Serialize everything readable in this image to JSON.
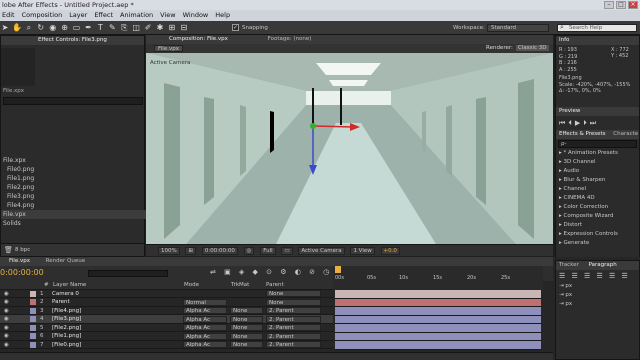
{
  "window": {
    "title": "lobe After Effects - Untitled Project.aep *",
    "controls": [
      "–",
      "□",
      "×"
    ]
  },
  "menu": [
    "Edit",
    "Composition",
    "Layer",
    "Effect",
    "Animation",
    "View",
    "Window",
    "Help"
  ],
  "toolbar": {
    "snapping_label": "Snapping",
    "workspace_label": "Workspace:",
    "workspace_value": "Standard",
    "search_placeholder": "Search Help"
  },
  "left_panel": {
    "tab_label": "Effect Controls: File3.png",
    "file_label": "File.xpx",
    "items": [
      "File.xpx",
      "File0.png",
      "File1.png",
      "File2.png",
      "File3.png",
      "File4.png",
      "File.vpx",
      "Solids"
    ],
    "bpc": "8 bpc"
  },
  "composition": {
    "tab_label": "Composition: File.vpx",
    "footage_tab": "Footage: (none)",
    "comp_button": "File.vpx",
    "renderer_label": "Renderer:",
    "renderer_value": "Classic 3D",
    "camera_label": "Active Camera"
  },
  "viewer_bar": {
    "zoom": "100%",
    "timecode": "0:00:00:00",
    "resolution": "Full",
    "camera": "Active Camera",
    "views": "1 View",
    "exposure": "+0.0"
  },
  "info": {
    "title": "Info",
    "r": "R : 193",
    "g": "G : 219",
    "b": "B : 216",
    "a": "A : 255",
    "x": "X : 772",
    "y": "Y : 452",
    "file": "File3.png",
    "scale": "Scale: -420%, -407%, -155%",
    "angle": "∆: -17%, 0%, 0%"
  },
  "preview": {
    "title": "Preview"
  },
  "effects": {
    "title": "Effects & Presets",
    "alt_tab": "Characte",
    "search_placeholder": "ρ-",
    "items": [
      "* Animation Presets",
      "3D Channel",
      "Audio",
      "Blur & Sharpen",
      "Channel",
      "CINEMA 4D",
      "Color Correction",
      "Composite Wizard",
      "Distort",
      "Expression Controls",
      "Generate"
    ]
  },
  "timeline": {
    "tab_label": "File.vpx",
    "render_queue": "Render Queue",
    "timecode": "0:00:00:00",
    "col_num": "#",
    "col_layer": "Layer Name",
    "col_mode": "Mode",
    "col_trk": "TrkMat",
    "col_parent": "Parent",
    "ruler": [
      "00s",
      "05s",
      "10s",
      "15s",
      "20s",
      "25s"
    ],
    "layers": [
      {
        "num": "1",
        "name": "Camera 0",
        "mode": "",
        "trk": "",
        "parent": "None",
        "color": "#c9b5b5"
      },
      {
        "num": "2",
        "name": "Parent",
        "mode": "Normal",
        "trk": "",
        "parent": "None",
        "color": "#c07070"
      },
      {
        "num": "3",
        "name": "[File4.png]",
        "mode": "Alpha Ac",
        "trk": "None",
        "parent": "2. Parent",
        "color": "#8f8fbb"
      },
      {
        "num": "4",
        "name": "[File3.png]",
        "mode": "Alpha Ac",
        "trk": "None",
        "parent": "2. Parent",
        "color": "#8f8fbb"
      },
      {
        "num": "5",
        "name": "[File2.png]",
        "mode": "Alpha Ac",
        "trk": "None",
        "parent": "2. Parent",
        "color": "#8f8fbb"
      },
      {
        "num": "6",
        "name": "[File1.png]",
        "mode": "Alpha Ac",
        "trk": "None",
        "parent": "2. Parent",
        "color": "#8f8fbb"
      },
      {
        "num": "7",
        "name": "[File0.png]",
        "mode": "Alpha Ac",
        "trk": "None",
        "parent": "2. Parent",
        "color": "#8f8fbb"
      }
    ]
  },
  "right_bottom": {
    "tracker": "Tracker",
    "paragraph": "Paragraph",
    "px1": "px",
    "px2": "px",
    "px3": "px"
  }
}
